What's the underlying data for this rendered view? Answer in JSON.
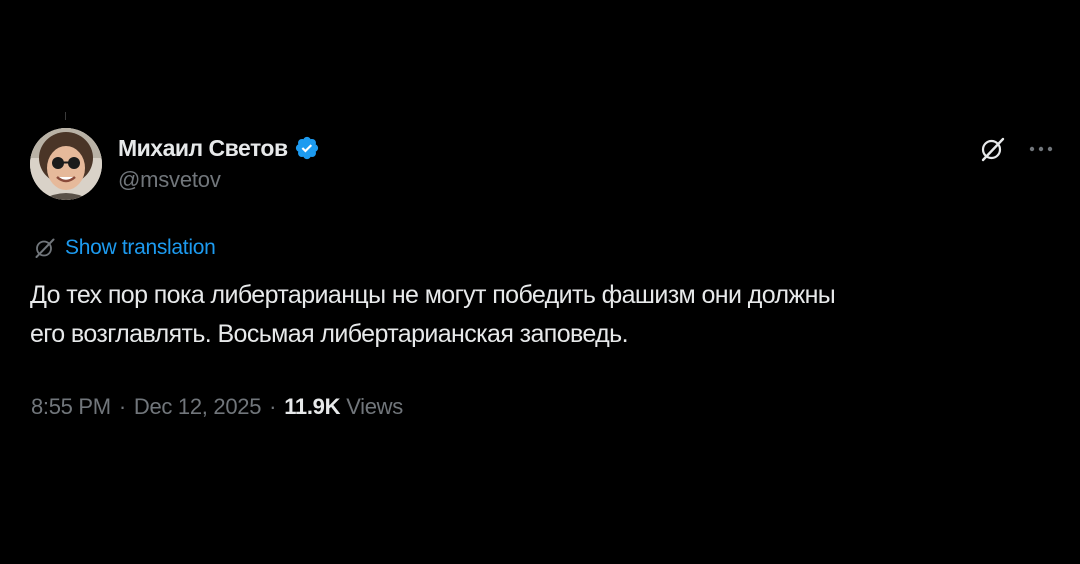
{
  "tweet": {
    "author": {
      "display_name": "Михаил Светов",
      "handle": "@msvetov",
      "verified": true,
      "avatar_icon": "user-avatar-photo"
    },
    "actions": {
      "grok_icon": "grok-icon",
      "more_icon": "more-options-icon"
    },
    "translate_label": "Show translation",
    "text_line1": "До тех пор пока либертарианцы не могут победить фашизм они должны",
    "text_line2": "его возглавлять. Восьмая либертарианская заповедь.",
    "time": "8:55 PM",
    "date": "Dec 12, 2025",
    "views_count": "11.9K",
    "views_label": "Views",
    "separator": "·"
  },
  "colors": {
    "background": "#000000",
    "text_primary": "#e7e9ea",
    "text_secondary": "#71767b",
    "accent_blue": "#1d9bf0"
  }
}
